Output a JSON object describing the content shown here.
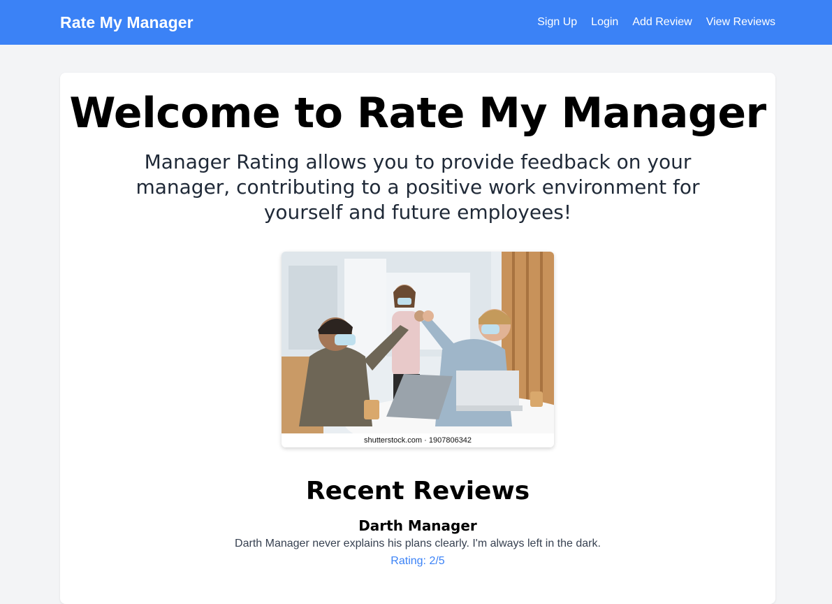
{
  "nav": {
    "brand": "Rate My Manager",
    "links": [
      {
        "label": "Sign Up"
      },
      {
        "label": "Login"
      },
      {
        "label": "Add Review"
      },
      {
        "label": "View Reviews"
      }
    ]
  },
  "hero": {
    "title": "Welcome to Rate My Manager",
    "subtitle": "Manager Rating allows you to provide feedback on your manager, contributing to a positive work environment for yourself and future employees!"
  },
  "image": {
    "caption": "shutterstock.com · 1907806342"
  },
  "reviews": {
    "title": "Recent Reviews",
    "items": [
      {
        "manager": "Darth Manager",
        "text": "Darth Manager never explains his plans clearly. I'm always left in the dark.",
        "rating": "Rating: 2/5"
      }
    ]
  },
  "colors": {
    "primary": "#3b82f6",
    "background": "#f3f4f6",
    "card": "#ffffff"
  }
}
